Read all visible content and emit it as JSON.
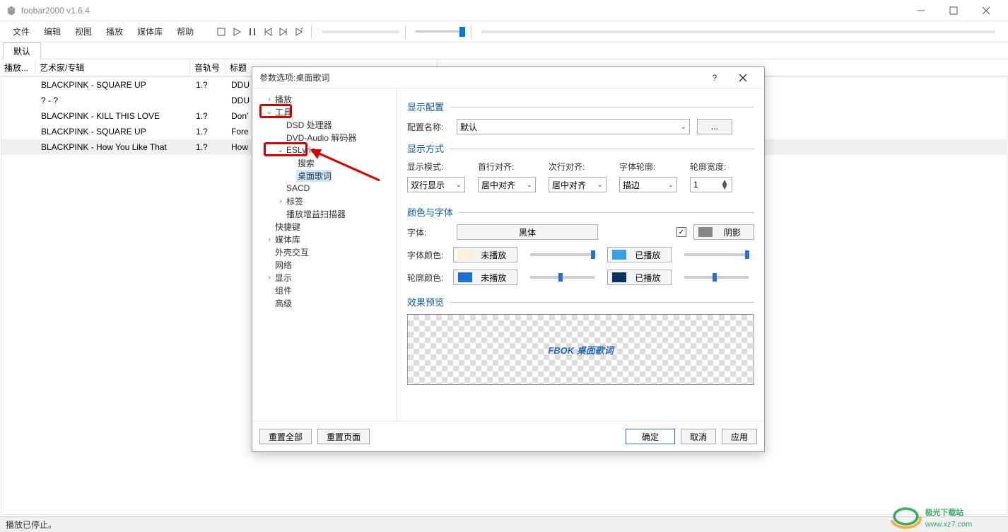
{
  "window": {
    "title": "foobar2000 v1.6.4"
  },
  "menu": [
    "文件",
    "编辑",
    "视图",
    "播放",
    "媒体库",
    "帮助"
  ],
  "tab": {
    "name": "默认"
  },
  "columns": {
    "play": "播放...",
    "artist": "艺术家/专辑",
    "track": "音轨号",
    "title": "标题"
  },
  "rows": [
    {
      "artist": "BLACKPINK - SQUARE UP",
      "track": "1.?",
      "title": "DDU"
    },
    {
      "artist": "? - ?",
      "track": "",
      "title": "DDU"
    },
    {
      "artist": "BLACKPINK - KILL THIS LOVE",
      "track": "1.?",
      "title": "Don'"
    },
    {
      "artist": "BLACKPINK - SQUARE UP",
      "track": "1.?",
      "title": "Fore"
    },
    {
      "artist": "BLACKPINK - How You Like That",
      "track": "1.?",
      "title": "How"
    }
  ],
  "status": "播放已停止。",
  "dialog": {
    "title": "参数选项:桌面歌词",
    "tree": {
      "playback": "播放",
      "tools": "工具",
      "dsd": "DSD 处理器",
      "dvd": "DVD-Audio 解码器",
      "eslyric": "ESLyric",
      "search": "搜索",
      "desktop": "桌面歌词",
      "sacd": "SACD",
      "tags": "标签",
      "gain": "播放增益扫描器",
      "shortcut": "快捷键",
      "library": "媒体库",
      "shell": "外壳交互",
      "network": "网络",
      "display": "显示",
      "component": "组件",
      "advanced": "高级"
    },
    "sections": {
      "display_config": "显示配置",
      "display_mode": "显示方式",
      "color_font": "颜色与字体",
      "preview": "效果预览"
    },
    "labels": {
      "config_name": "配置名称:",
      "mode": "显示模式:",
      "first_align": "首行对齐:",
      "second_align": "次行对齐:",
      "outline": "字体轮廓:",
      "outline_width": "轮廓宽度:",
      "font": "字体:",
      "shadow": "阴影",
      "font_color": "字体颜色:",
      "outline_color": "轮廓颜色:",
      "not_played": "未播放",
      "played": "已播放"
    },
    "values": {
      "config_name": "默认",
      "mode": "双行显示",
      "first_align": "居中对齐",
      "second_align": "居中对齐",
      "outline": "描边",
      "outline_width": "1",
      "font": "黑体",
      "more": "...",
      "shadow_checked": "☑"
    },
    "preview_text": "FBOK 桌面歌词",
    "buttons": {
      "reset_all": "重置全部",
      "reset_page": "重置页面",
      "ok": "确定",
      "cancel": "取消",
      "apply": "应用"
    }
  },
  "watermark": {
    "brand": "极光下载站",
    "url": "www.xz7.com"
  }
}
